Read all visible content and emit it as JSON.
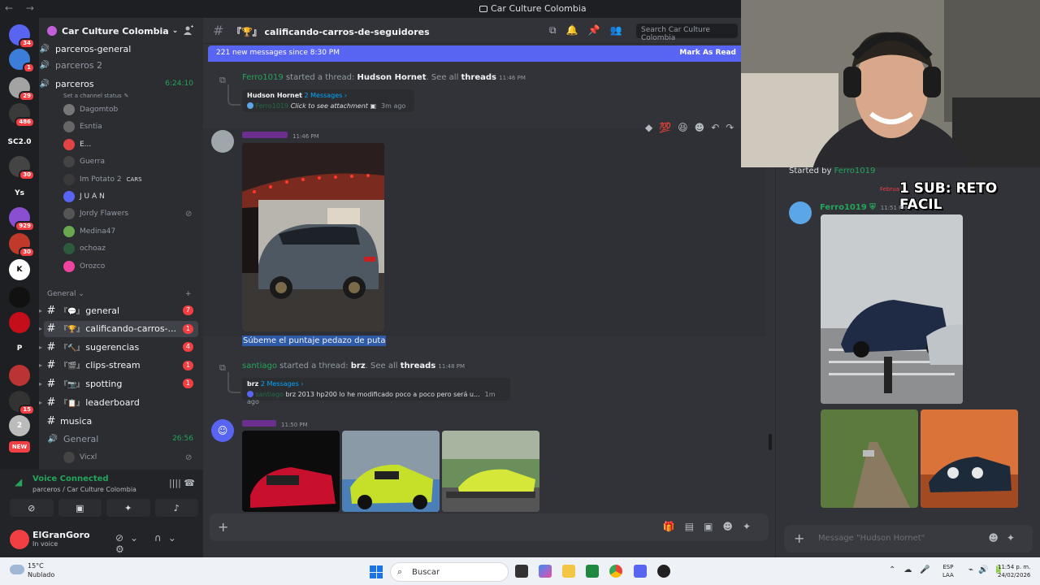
{
  "window": {
    "title": "Car Culture Colombia",
    "nav": "← →"
  },
  "server": {
    "name": "Car Culture Colombia"
  },
  "guilds": [
    {
      "label": "",
      "badge": "34",
      "color": "#5865f2"
    },
    {
      "label": "",
      "badge": "1",
      "color": "#3b7dd8"
    },
    {
      "label": "",
      "badge": "29",
      "color": "#a3a3a3"
    },
    {
      "label": "",
      "badge": "486",
      "color": "#3a3a3a"
    },
    {
      "label": "SC2.0",
      "badge": "",
      "color": "#1e1f22"
    },
    {
      "label": "",
      "badge": "30",
      "color": "#444"
    },
    {
      "label": "Ys",
      "badge": "",
      "color": "#1e1f22"
    },
    {
      "label": "",
      "badge": "929",
      "color": "#8a4fd0"
    },
    {
      "label": "",
      "badge": "30",
      "color": "#c0392b"
    },
    {
      "label": "K",
      "badge": "",
      "color": "#fff"
    },
    {
      "label": "",
      "badge": "",
      "color": "#111"
    },
    {
      "label": "",
      "badge": "",
      "color": "#c40f1a"
    },
    {
      "label": "P",
      "badge": "",
      "color": "#1e1f22"
    },
    {
      "label": "",
      "badge": "",
      "color": "#b33"
    },
    {
      "label": "",
      "badge": "15",
      "color": "#333"
    },
    {
      "label": "2",
      "badge": "",
      "color": "#bbb"
    },
    {
      "label": "NEW",
      "badge": "",
      "color": "#f23f43"
    }
  ],
  "sidebar": {
    "voice_channels_top": [
      {
        "name": "parceros-general"
      },
      {
        "name": "parceros 2"
      }
    ],
    "active_voice": {
      "name": "parceros",
      "timer": "6:24:10",
      "status_hint": "Set a channel status"
    },
    "members": [
      {
        "name": "Dagomtob",
        "color": "#777",
        "tag": ""
      },
      {
        "name": "Esntia",
        "color": "#666",
        "tag": ""
      },
      {
        "name": "E...",
        "color": "#e04444",
        "tag": ""
      },
      {
        "name": "Guerra",
        "color": "#444",
        "tag": ""
      },
      {
        "name": "Im Potato 2",
        "color": "#3a3a3a",
        "tag": "CARS"
      },
      {
        "name": "J U A N",
        "color": "#5865f2",
        "tag": ""
      },
      {
        "name": "Jordy Flawers",
        "color": "#555",
        "tag": ""
      },
      {
        "name": "Medina47",
        "color": "#6aa84f",
        "tag": ""
      },
      {
        "name": "ochoaz",
        "color": "#2d5a3a",
        "tag": ""
      },
      {
        "name": "Orozco",
        "color": "#eb459e",
        "tag": ""
      }
    ],
    "category": "General",
    "text_channels": [
      {
        "name": "general",
        "prefix": "『💬』",
        "count": "7"
      },
      {
        "name": "calificando-carros-...",
        "prefix": "『🏆』",
        "count": "1"
      },
      {
        "name": "sugerencias",
        "prefix": "『🔨』",
        "count": "4"
      },
      {
        "name": "clips-stream",
        "prefix": "『🎬』",
        "count": "1"
      },
      {
        "name": "spotting",
        "prefix": "『📷』",
        "count": "1"
      },
      {
        "name": "leaderboard",
        "prefix": "『📋』",
        "count": ""
      }
    ],
    "musica": "musica",
    "general_voice": {
      "name": "General",
      "timer": "26:56"
    },
    "vicxl": "Vicxl"
  },
  "voice_panel": {
    "title": "Voice Connected",
    "subtitle": "parceros / Car Culture Colombia"
  },
  "user": {
    "name": "ElGranGoro",
    "status": "In voice"
  },
  "chat": {
    "channel_name": "『🏆』 calificando-carros-de-seguidores",
    "search_placeholder": "Search Car Culture Colombia",
    "banner_text": "221 new messages since 8:30 PM",
    "banner_action": "Mark As Read",
    "thread1": {
      "starter": "Ferro1019",
      "started": " started a thread: ",
      "name": "Hudson Hornet",
      "see_all": ". See all ",
      "threads": "threads",
      "time": "11:46 PM",
      "card_title": "Hudson Hornet",
      "card_count": "2 Messages ›",
      "card_user": "Ferro1019",
      "card_text": "Click to see attachment",
      "card_ago": "3m ago"
    },
    "message1": {
      "author": "",
      "time": "11:46 PM",
      "text": "Súbeme el puntaje pedazo de puta"
    },
    "thread2": {
      "starter": "santiago",
      "started": " started a thread: ",
      "name": "brz",
      "see_all": ". See all ",
      "threads": "threads",
      "time": "11:48 PM",
      "card_title": "brz",
      "card_count": "2 Messages ›",
      "card_user": "santiago",
      "card_text": "brz 2013 hp200 lo he modificado poco a poco pero será u...",
      "card_ago": "1m ago"
    },
    "message2": {
      "author": "",
      "time": "11:50 PM"
    }
  },
  "thread_panel": {
    "started_by_label": "Started by ",
    "started_by_user": "Ferro1019",
    "date_fragment": "Februa",
    "overlay_text": "1 SUB: RETO FACIL",
    "author": "Ferro1019",
    "time": "11:51 PM",
    "composer_placeholder": "Message \"Hudson Hornet\""
  },
  "taskbar": {
    "temp": "15°C",
    "weather": "Nublado",
    "search": "Buscar",
    "lang1": "ESP",
    "lang2": "LAA",
    "time": "11:54 p. m.",
    "date": "24/02/2026"
  },
  "colors": {
    "accent": "#5865f2",
    "online": "#23a55a",
    "mention": "#f23f43"
  }
}
